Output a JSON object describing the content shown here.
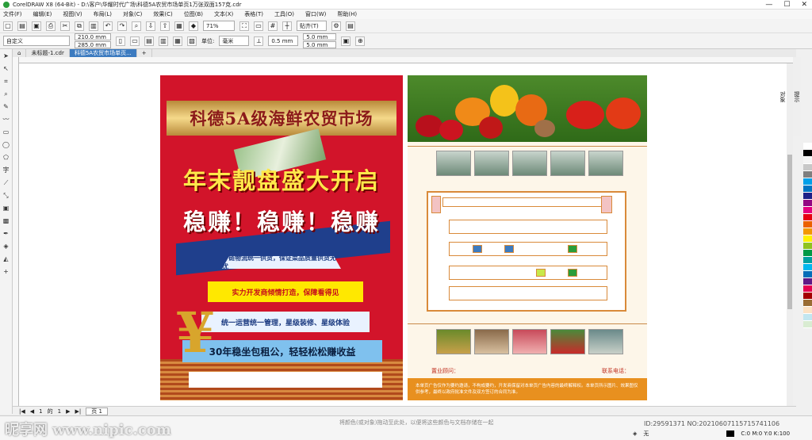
{
  "window": {
    "title": "CorelDRAW X8 (64-Bit) - D:\\客户\\华耀时代广场\\科德5A农贸市场单页1万张双面157克.cdr",
    "controls": [
      "—",
      "☐",
      "✕"
    ]
  },
  "menu": [
    "文件(F)",
    "编辑(E)",
    "视图(V)",
    "布局(L)",
    "对象(C)",
    "效果(C)",
    "位图(B)",
    "文本(X)",
    "表格(T)",
    "工具(O)",
    "窗口(W)",
    "帮助(H)"
  ],
  "toolbar": {
    "zoom": "71%",
    "snap": "贴齐(T)"
  },
  "props": {
    "preset": "自定义",
    "width": "210.0 mm",
    "height": "285.0 mm",
    "units_label": "单位:",
    "units": "毫米",
    "nudge": "0.5 mm",
    "dup_x": "5.0 mm",
    "dup_y": "5.0 mm"
  },
  "tabs": [
    "未标题-1.cdr",
    "科德5A农贸市场单页..."
  ],
  "page_nav": {
    "current": "1",
    "of": "的",
    "total": "1",
    "page_tab": "页 1"
  },
  "status": {
    "hint": "将颜色(或对象)拖动至此处，以便将这些颜色与文档存储在一起",
    "coords": "( 1…, 376…)",
    "fill": "无",
    "color_model": "C:0 M:0 Y:0 K:100"
  },
  "watermark": "昵享网 www.nipic.com",
  "image_id": "ID:29591371 NO:20210607115715741106",
  "flyer_left": {
    "banner": "科德5A级海鲜农贸市场",
    "headline1": "年末靓盘盛大开启",
    "headline2": "稳赚！稳赚！稳赚",
    "bar1": "冷链物流统一供货，保证菜品质量供货无忧",
    "bar2": "实力开发商倾情打造，保障看得见",
    "bar3": "统一运营统一管理，星级装修、星级体验",
    "bar4": "30年稳坐包租公，轻轻松松赚收益"
  },
  "flyer_right": {
    "address_label": "置业顾问：",
    "phone_label": "联系电话：",
    "footer": "本单页广告仅作为要约邀请，不构成要约，开发商保留对本单页广告内容的最终解释权。本单页所示图片、效果图仅供参考，最终以政府批准文件及双方签订的合同为准。"
  },
  "palette": [
    "#ffffff",
    "#000000",
    "#f5f5f5",
    "#c8c8c8",
    "#7f7f7f",
    "#00a0e9",
    "#0075c2",
    "#1d2088",
    "#920783",
    "#e4007f",
    "#e60012",
    "#eb6100",
    "#f39800",
    "#fff100",
    "#8fc31f",
    "#009944",
    "#00a0a0",
    "#00b7ee",
    "#036eb8",
    "#601986",
    "#e5004f",
    "#a40000",
    "#996c33",
    "#fce2c4",
    "#c2e6f0",
    "#d9ecd2"
  ]
}
